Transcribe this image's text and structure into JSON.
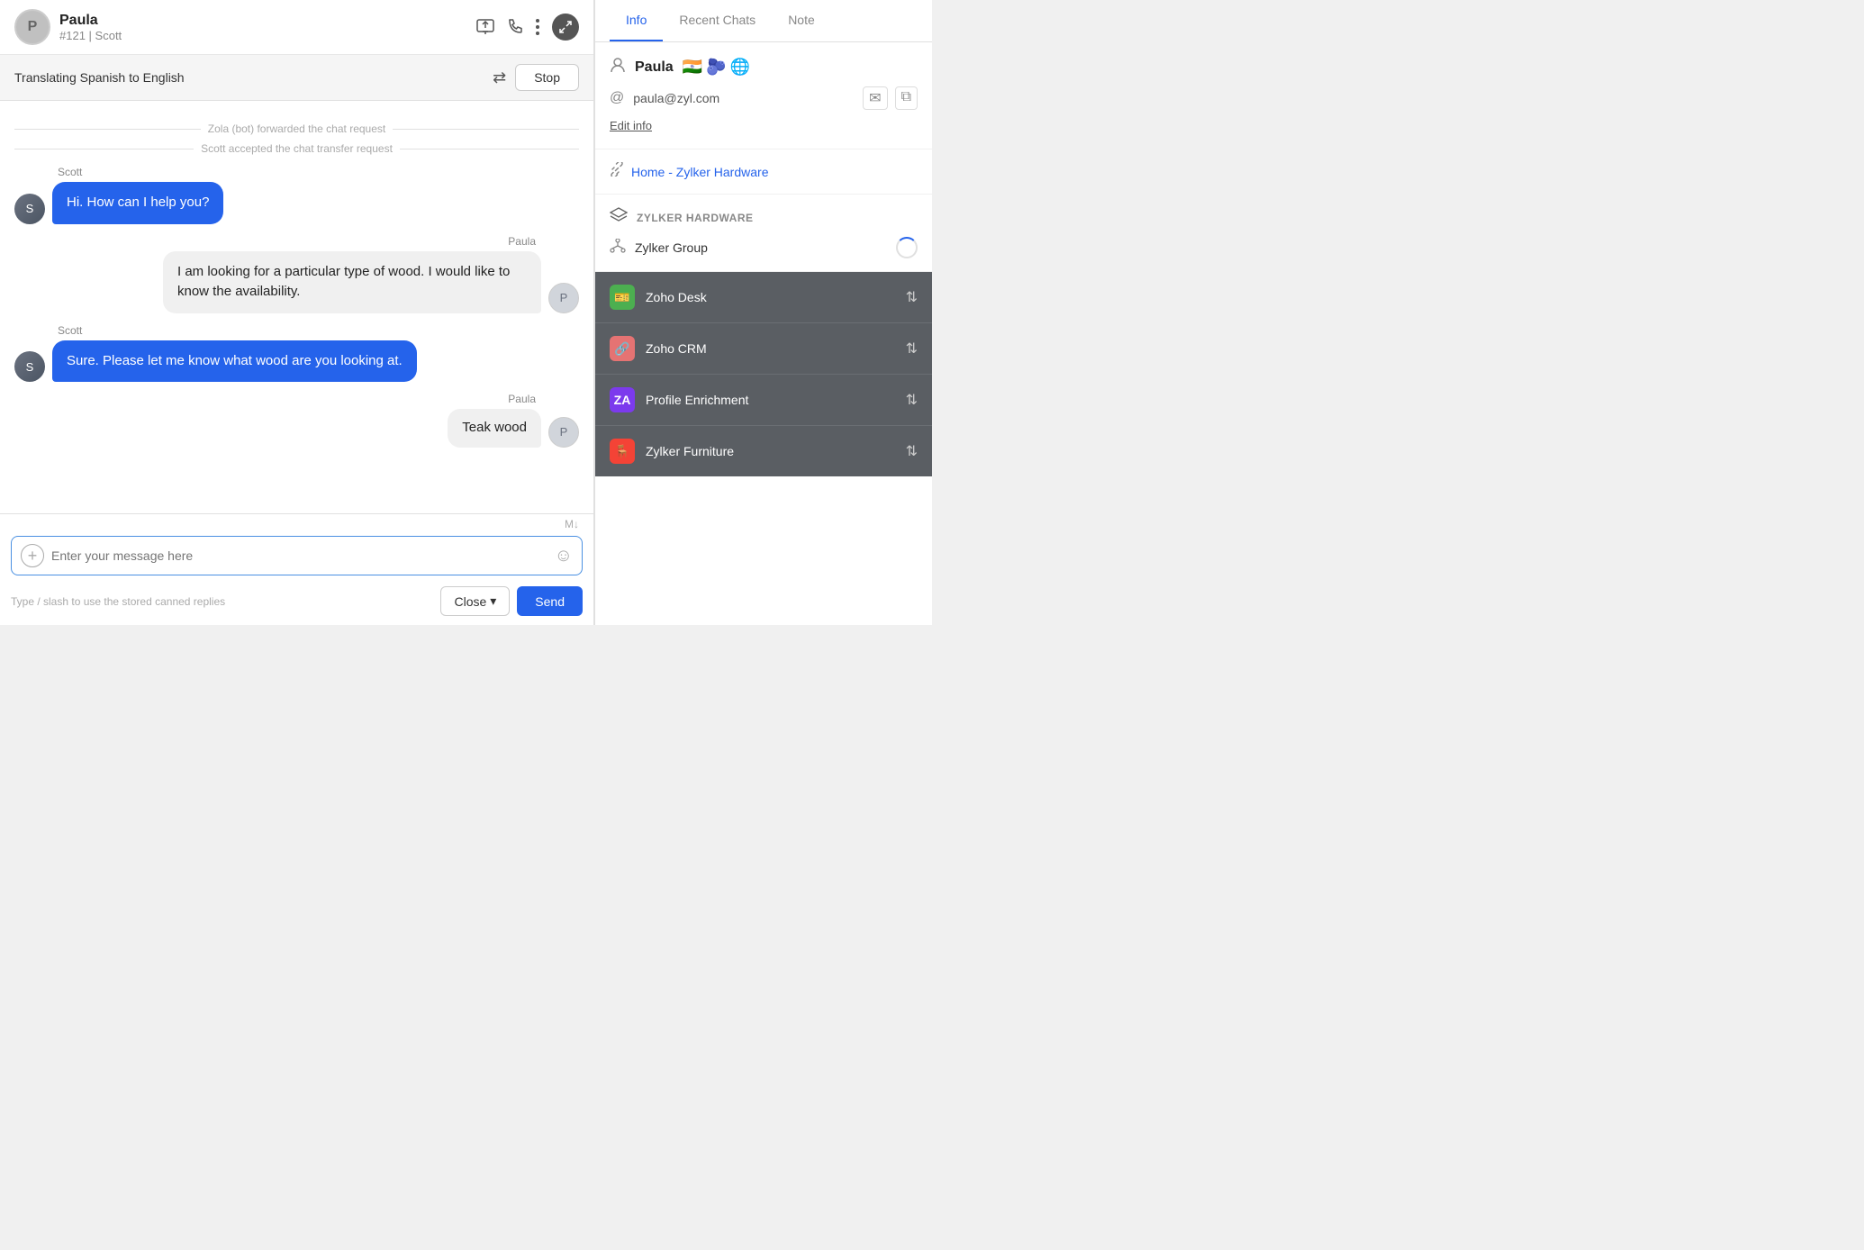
{
  "header": {
    "contact_name": "Paula",
    "contact_id": "#121",
    "contact_agent": "Scott",
    "avatar_initials": "P",
    "expand_tooltip": "Expand"
  },
  "translation_bar": {
    "text": "Translating Spanish to English",
    "stop_label": "Stop"
  },
  "messages": {
    "system_messages": [
      "Zola (bot) forwarded the chat request",
      "Scott accepted the chat transfer request"
    ],
    "items": [
      {
        "id": 1,
        "sender": "Scott",
        "type": "agent",
        "text": "Hi. How can I help you?"
      },
      {
        "id": 2,
        "sender": "Paula",
        "type": "visitor",
        "text": "I am looking for a particular type of wood. I would like to know the availability."
      },
      {
        "id": 3,
        "sender": "Scott",
        "type": "agent",
        "text": "Sure. Please let me know what wood are you looking at."
      },
      {
        "id": 4,
        "sender": "Paula",
        "type": "visitor",
        "text": "Teak wood"
      }
    ]
  },
  "input": {
    "placeholder": "Enter your message here",
    "canned_hint": "Type / slash to use the stored canned replies",
    "close_label": "Close",
    "send_label": "Send"
  },
  "right_panel": {
    "tabs": [
      {
        "id": "info",
        "label": "Info",
        "active": true
      },
      {
        "id": "recent_chats",
        "label": "Recent Chats",
        "active": false
      },
      {
        "id": "note",
        "label": "Note",
        "active": false
      }
    ],
    "contact": {
      "name": "Paula",
      "email": "paula@zyl.com",
      "flags": [
        "🇮🇳",
        "🫐",
        "🌐"
      ],
      "edit_label": "Edit info"
    },
    "link": {
      "text": "Home - Zylker Hardware"
    },
    "company": {
      "name": "ZYLKER HARDWARE",
      "group": "Zylker Group"
    },
    "integrations": [
      {
        "id": "zoho_desk",
        "name": "Zoho Desk",
        "icon_color": "#4caf50",
        "icon_char": "🎫"
      },
      {
        "id": "zoho_crm",
        "name": "Zoho CRM",
        "icon_color": "#e57373",
        "icon_char": "🔗"
      },
      {
        "id": "profile_enrichment",
        "name": "Profile Enrichment",
        "icon_color": "#9c27b0",
        "icon_char": "✦"
      },
      {
        "id": "zylker_furniture",
        "name": "Zylker Furniture",
        "icon_color": "#f44336",
        "icon_char": "🪑"
      }
    ]
  }
}
